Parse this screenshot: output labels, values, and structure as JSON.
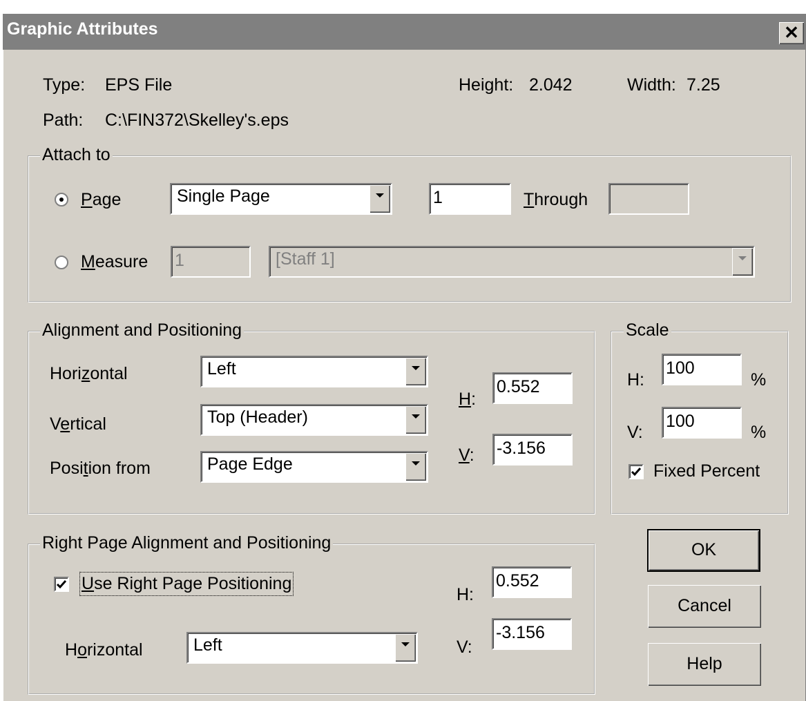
{
  "titlebar": {
    "title": "Graphic Attributes",
    "close_glyph": "✕"
  },
  "info": {
    "type_label": "Type:",
    "type_value": "EPS File",
    "height_label": "Height:",
    "height_value": "2.042",
    "width_label": "Width:",
    "width_value": "7.25",
    "path_label": "Path:",
    "path_value": "C:\\FIN372\\Skelley's.eps"
  },
  "attach": {
    "legend": "Attach to",
    "page_radio": {
      "mnemonic": "P",
      "rest": "age",
      "selected": true
    },
    "page_combo": "Single Page",
    "page_from": "1",
    "through": {
      "mnemonic": "T",
      "rest": "hrough",
      "value": ""
    },
    "measure_radio": {
      "mnemonic": "M",
      "rest": "easure",
      "selected": false
    },
    "measure_value": "1",
    "staff_combo": "[Staff 1]"
  },
  "alignment": {
    "legend": "Alignment and Positioning",
    "horizontal": {
      "pre": "Hori",
      "mnemonic": "z",
      "post": "ontal",
      "value": "Left"
    },
    "vertical": {
      "pre": "V",
      "mnemonic": "e",
      "post": "rtical",
      "value": "Top (Header)"
    },
    "position_from": {
      "pre": "Posi",
      "mnemonic": "t",
      "post": "ion from",
      "value": "Page Edge"
    },
    "h": {
      "mnemonic": "H",
      "post": ":",
      "value": "0.552"
    },
    "v": {
      "mnemonic": "V",
      "post": ":",
      "value": "-3.156"
    }
  },
  "scale": {
    "legend": "Scale",
    "h_label": "H:",
    "h_value": "100",
    "h_unit": "%",
    "v_label": "V:",
    "v_value": "100",
    "v_unit": "%",
    "fixed_percent": {
      "label": "Fixed Percent",
      "checked": true
    }
  },
  "right_page": {
    "legend": "Right Page Alignment and Positioning",
    "use_right": {
      "mnemonic": "U",
      "rest": "se Right Page Positioning",
      "checked": true
    },
    "horizontal": {
      "pre": "H",
      "mnemonic": "o",
      "post": "rizontal",
      "value": "Left"
    },
    "h_label": "H:",
    "h_value": "0.552",
    "v_label": "V:",
    "v_value": "-3.156"
  },
  "buttons": {
    "ok": "OK",
    "cancel": "Cancel",
    "help": "Help"
  }
}
